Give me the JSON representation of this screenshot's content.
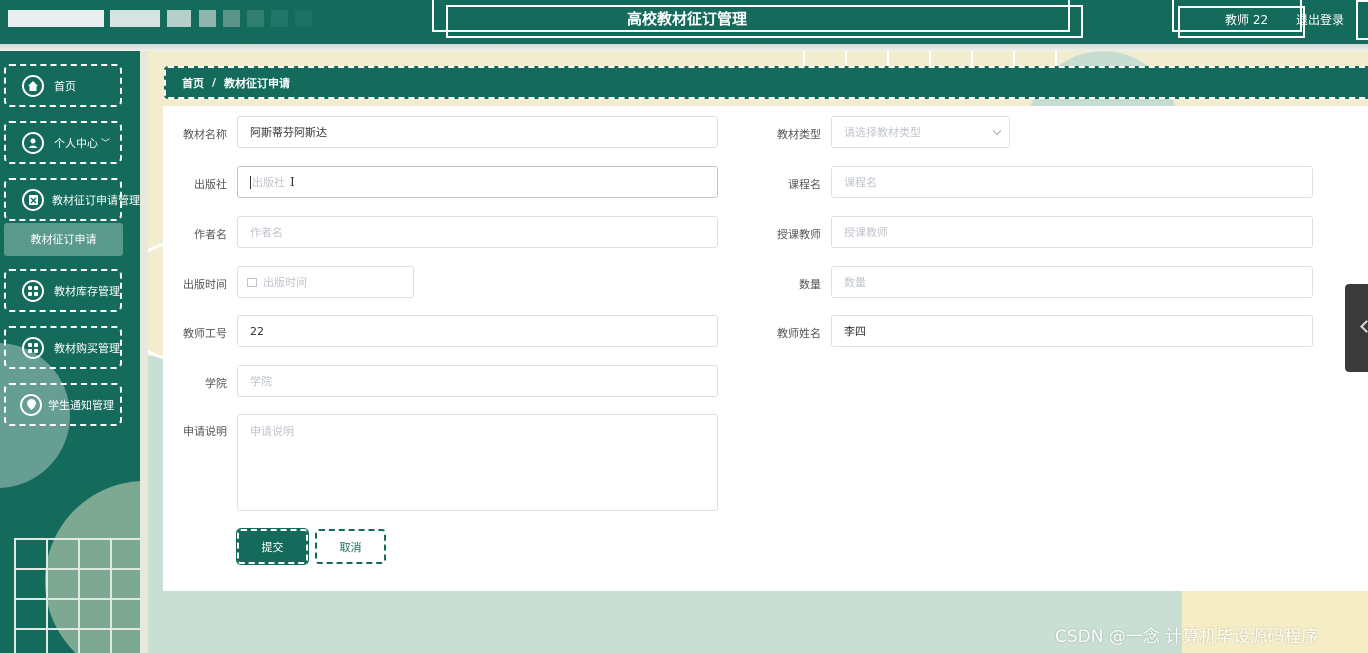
{
  "header": {
    "title": "高校教材征订管理",
    "user_label": "教师 22",
    "logout_label": "退出登录"
  },
  "sidebar": {
    "items": [
      {
        "label": "首页",
        "icon": "home-icon"
      },
      {
        "label": "个人中心",
        "icon": "user-icon",
        "suffix": "﹀"
      },
      {
        "label": "教材征订申请管理",
        "icon": "apply-icon"
      },
      {
        "label": "教材库存管理",
        "icon": "grid-icon"
      },
      {
        "label": "教材购买管理",
        "icon": "grid-icon"
      },
      {
        "label": "学生通知管理",
        "icon": "location-icon"
      }
    ],
    "submenu": {
      "label": "教材征订申请"
    }
  },
  "breadcrumb": {
    "home": "首页",
    "separator": "/",
    "current": "教材征订申请"
  },
  "form": {
    "textbook_name": {
      "label": "教材名称",
      "value": "阿斯蒂芬阿斯达"
    },
    "textbook_type": {
      "label": "教材类型",
      "placeholder": "请选择教材类型"
    },
    "publisher": {
      "label": "出版社",
      "placeholder": "出版社"
    },
    "course_name": {
      "label": "课程名",
      "placeholder": "课程名"
    },
    "author": {
      "label": "作者名",
      "placeholder": "作者名"
    },
    "teacher": {
      "label": "授课教师",
      "placeholder": "授课教师"
    },
    "publish_date": {
      "label": "出版时间",
      "placeholder": "出版时间"
    },
    "quantity": {
      "label": "数量",
      "placeholder": "数量"
    },
    "teacher_id": {
      "label": "教师工号",
      "value": "22"
    },
    "teacher_name": {
      "label": "教师姓名",
      "value": "李四"
    },
    "college": {
      "label": "学院",
      "placeholder": "学院"
    },
    "description": {
      "label": "申请说明",
      "placeholder": "申请说明"
    },
    "submit_label": "提交",
    "cancel_label": "取消"
  },
  "watermark": "CSDN @一念 计算机毕设源码程序",
  "colors": {
    "primary": "#146b5b",
    "accent_light": "#5a9a8d",
    "cream": "#f3edd0"
  }
}
